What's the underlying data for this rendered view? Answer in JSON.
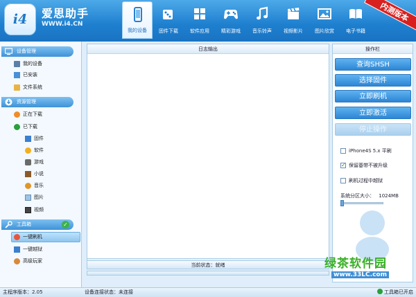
{
  "header": {
    "brand_name": "爱思助手",
    "brand_url": "WWW.i4.CN",
    "logo_text": "i4",
    "ribbon": "内测版本",
    "nav": [
      {
        "label": "我的设备",
        "icon": "phone-icon"
      },
      {
        "label": "固件下载",
        "icon": "dice-icon"
      },
      {
        "label": "软件应用",
        "icon": "grid-icon"
      },
      {
        "label": "精彩游戏",
        "icon": "gamepad-icon"
      },
      {
        "label": "音乐铃声",
        "icon": "music-note-icon"
      },
      {
        "label": "视频影片",
        "icon": "clapperboard-icon"
      },
      {
        "label": "图片欣赏",
        "icon": "picture-icon"
      },
      {
        "label": "电子书籍",
        "icon": "book-icon"
      }
    ]
  },
  "sidebar": {
    "device_section": "设备管理",
    "device_items": [
      "我的设备",
      "已安装",
      "文件系统"
    ],
    "resource_section": "资源管理",
    "resource_items": [
      "正在下载",
      "已下载"
    ],
    "downloaded_items": [
      "固件",
      "软件",
      "游戏",
      "小说",
      "音乐",
      "图片",
      "视频"
    ],
    "toolbox_section": "工具箱",
    "toolbox_items": [
      "一键刷机",
      "一键越狱",
      "高级玩家"
    ]
  },
  "log": {
    "title": "日志输出",
    "status": "当前状态：就绪"
  },
  "ops": {
    "title": "操作栏",
    "buttons": [
      "查询SHSH",
      "选择固件",
      "立即刷机",
      "立即激活",
      "停止操作"
    ],
    "options": [
      {
        "label": "iPhone4S 5.x 平刷",
        "checked": false
      },
      {
        "label": "保留基带不被升级",
        "checked": true
      },
      {
        "label": "刷机过程中越狱",
        "checked": false
      }
    ],
    "partition_label": "系统分区大小：",
    "partition_value": "1024MB"
  },
  "footer": {
    "version": "主程序版本：2.05",
    "connection": "设备连接状态：未连接",
    "toolbox_status": "工具箱已开启"
  },
  "watermark": {
    "logo": "绿茶软件园",
    "url": "www.33LC.com"
  },
  "colors": {
    "header_blue": "#1e7fcf",
    "button_blue": "#2d86d5",
    "ribbon_red": "#d8201f",
    "ok_green": "#2aa03a"
  }
}
